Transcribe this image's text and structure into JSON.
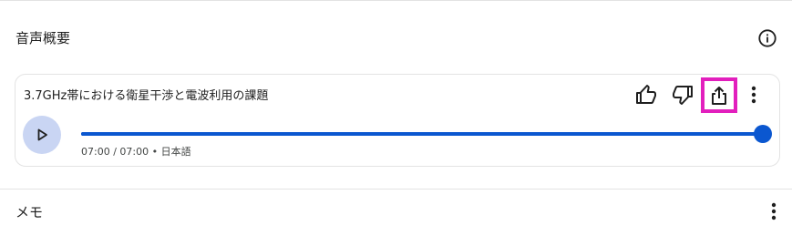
{
  "overview": {
    "title": "音声概要",
    "info_icon": "info-icon"
  },
  "audio": {
    "title": "3.7GHz帯における衛星干渉と電波利用の課題",
    "time_current": "07:00",
    "time_total": "07:00",
    "language": "日本語",
    "time_text": "07:00 / 07:00 • 日本語",
    "progress": 1.0,
    "actions": [
      {
        "name": "thumbs-up-icon"
      },
      {
        "name": "thumbs-down-icon"
      },
      {
        "name": "share-icon"
      },
      {
        "name": "more-vert-icon"
      }
    ],
    "play_icon": "play-icon"
  },
  "memo": {
    "title": "メモ",
    "more_icon": "more-vert-icon"
  },
  "colors": {
    "accent": "#0b57d0",
    "play_bg": "#c9d5f3",
    "highlight": "#e21fbd",
    "divider": "#e3e3e3"
  }
}
